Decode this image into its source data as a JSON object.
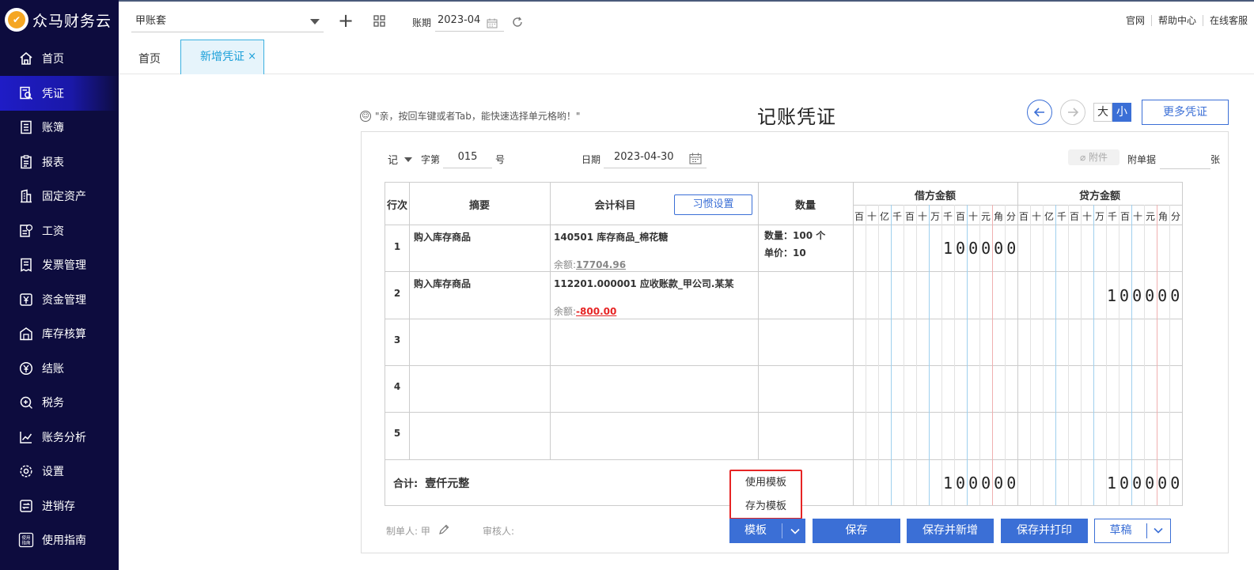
{
  "app": {
    "name": "众马财务云"
  },
  "sidebar": {
    "items": [
      {
        "label": "首页",
        "icon": "home-icon"
      },
      {
        "label": "凭证",
        "icon": "voucher-icon",
        "active": true
      },
      {
        "label": "账簿",
        "icon": "ledger-icon"
      },
      {
        "label": "报表",
        "icon": "report-icon"
      },
      {
        "label": "固定资产",
        "icon": "building-icon"
      },
      {
        "label": "工资",
        "icon": "salary-icon"
      },
      {
        "label": "发票管理",
        "icon": "invoice-icon"
      },
      {
        "label": "资金管理",
        "icon": "yen-icon"
      },
      {
        "label": "库存核算",
        "icon": "warehouse-icon"
      },
      {
        "label": "结账",
        "icon": "checkout-icon"
      },
      {
        "label": "税务",
        "icon": "tax-icon"
      },
      {
        "label": "账务分析",
        "icon": "chart-icon"
      },
      {
        "label": "设置",
        "icon": "gear-icon"
      },
      {
        "label": "进销存",
        "icon": "inventory-icon"
      },
      {
        "label": "使用指南",
        "icon": "guide-icon"
      }
    ],
    "active_color": "#1f1cc6",
    "bg_color": "#0d0c3e"
  },
  "topbar": {
    "account_set": "甲账套",
    "period_label": "账期",
    "period_value": "2023-04",
    "links": [
      "官网",
      "帮助中心",
      "在线客服"
    ]
  },
  "tabs": {
    "home": "首页",
    "current": "新增凭证",
    "close_glyph": "×"
  },
  "voucher": {
    "hint": "\"亲，按回车键或者Tab，能快速选择单元格哟！\"",
    "title": "记账凭证",
    "size_large": "大",
    "size_small": "小",
    "more_label": "更多凭证",
    "type": "记",
    "zi_label": "字第",
    "number": "015",
    "hao_label": "号",
    "date_label": "日期",
    "date": "2023-04-30",
    "attach_label": "附件",
    "attach_docs_label": "附单据",
    "attach_unit": "张",
    "columns": {
      "row": "行次",
      "summary": "摘要",
      "account": "会计科目",
      "habit_button": "习惯设置",
      "quantity": "数量",
      "debit": "借方金额",
      "credit": "贷方金额",
      "units": [
        "百",
        "十",
        "亿",
        "千",
        "百",
        "十",
        "万",
        "千",
        "百",
        "十",
        "元",
        "角",
        "分"
      ]
    },
    "rows": [
      {
        "no": "1",
        "summary": "购入库存商品",
        "account": "140501 库存商品_棉花糖",
        "balance_label": "余额:",
        "balance": "17704.96",
        "qty_line1": "数量：100 个",
        "qty_line2": "单价：10",
        "debit": "100000",
        "credit": ""
      },
      {
        "no": "2",
        "summary": "购入库存商品",
        "account": "112201.000001 应收账款_甲公司.某某",
        "balance_label": "余额:",
        "balance": "-800.00",
        "qty_line1": "",
        "qty_line2": "",
        "debit": "",
        "credit": "100000"
      },
      {
        "no": "3"
      },
      {
        "no": "4"
      },
      {
        "no": "5"
      }
    ],
    "total_label": "合计:",
    "total_words": "壹仟元整",
    "total_debit": "100000",
    "total_credit": "100000",
    "maker_label": "制单人: 甲",
    "checker_label": "审核人:",
    "template_menu": [
      "使用模板",
      "存为模板"
    ],
    "buttons": {
      "template": "模板",
      "save": "保存",
      "save_new": "保存并新增",
      "save_print": "保存并打印",
      "draft": "草稿"
    },
    "accent_color": "#3b6fd6",
    "negative_color": "#e62424"
  }
}
